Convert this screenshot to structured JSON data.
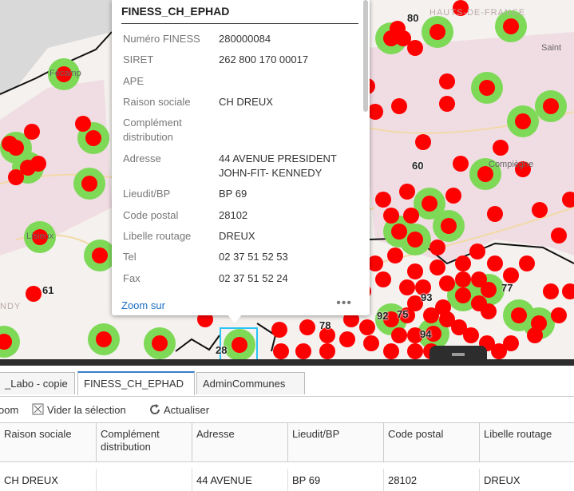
{
  "map": {
    "region_label": "HAUTS-DE-FRANCE",
    "region_label_2": "NDY",
    "cities": [
      "Fécamp",
      "Saint",
      "Compiègne",
      "Lisieux"
    ],
    "dept_labels": [
      "80",
      "60",
      "61",
      "77",
      "93",
      "92",
      "75",
      "78",
      "94",
      "28"
    ],
    "colors": {
      "point": "#ff0000",
      "halo": "#7ed957",
      "highlight": "#27c4f5",
      "boundary": "#111111"
    }
  },
  "popup": {
    "title": "FINESS_CH_EPHAD",
    "fields": [
      {
        "label": "Numéro FINESS",
        "value": "280000084"
      },
      {
        "label": "SIRET",
        "value": "262 800 170 00017"
      },
      {
        "label": "APE",
        "value": ""
      },
      {
        "label": "Raison sociale",
        "value": "CH DREUX"
      },
      {
        "label": "Complément distribution",
        "value": ""
      },
      {
        "label": "Adresse",
        "value": "44 AVENUE PRESIDENT JOHN-FIT- KENNEDY"
      },
      {
        "label": "Lieudit/BP",
        "value": "BP 69"
      },
      {
        "label": "Code postal",
        "value": "28102"
      },
      {
        "label": "Libelle routage",
        "value": "DREUX"
      },
      {
        "label": "Tel",
        "value": "02 37 51 52 53"
      },
      {
        "label": "Fax",
        "value": "02 37 51 52 24"
      }
    ],
    "zoom_label": "Zoom sur",
    "more_icon": "more-icon"
  },
  "tabs": [
    {
      "label": "_Labo - copie",
      "active": false
    },
    {
      "label": "FINESS_CH_EPHAD",
      "active": true
    },
    {
      "label": "AdminCommunes",
      "active": false
    }
  ],
  "toolbar": {
    "zoom_label": "oom",
    "clear_label": "Vider la sélection",
    "refresh_label": "Actualiser"
  },
  "table": {
    "columns": [
      "Raison sociale",
      "Complément distribution",
      "Adresse",
      "Lieudit/BP",
      "Code postal",
      "Libelle routage"
    ],
    "rows": [
      [
        "CH DREUX",
        "",
        "44 AVENUE",
        "BP 69",
        "28102",
        "DREUX"
      ]
    ]
  }
}
